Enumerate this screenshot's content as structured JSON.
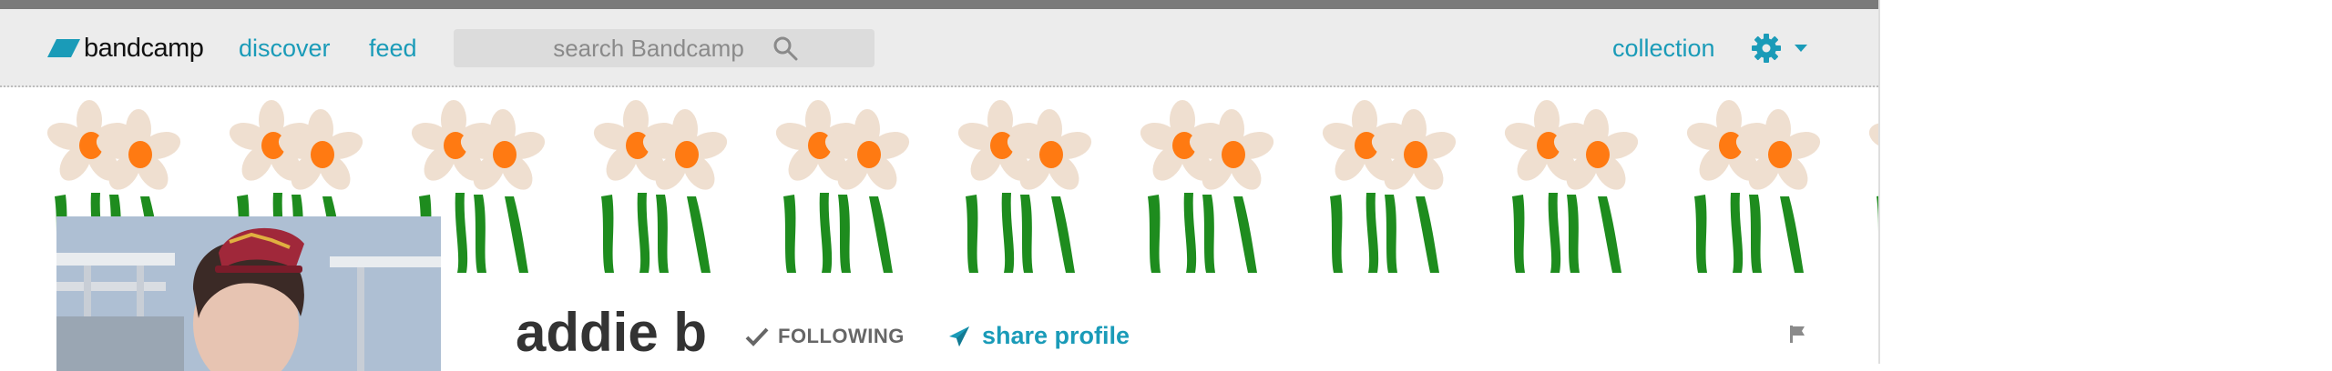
{
  "brand": {
    "logo_text": "bandcamp",
    "accent_color": "#1a9bb8"
  },
  "nav": {
    "discover": "discover",
    "feed": "feed",
    "collection": "collection"
  },
  "search": {
    "placeholder": "search Bandcamp"
  },
  "banner": {
    "motif": "daffodils",
    "petal_color": "#efdfd0",
    "cup_color": "#ff7a12",
    "stem_color": "#1e8c1e"
  },
  "profile": {
    "name": "addie b",
    "following_label": "FOLLOWING",
    "share_label": "share profile"
  },
  "icons": [
    "bandcamp-logo-icon",
    "search-icon",
    "gear-icon",
    "chevron-down-icon",
    "check-icon",
    "share-icon",
    "flag-icon"
  ]
}
